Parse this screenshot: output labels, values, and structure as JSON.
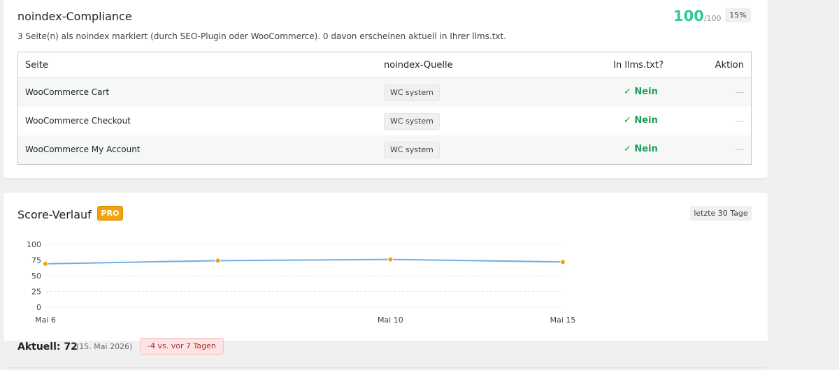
{
  "compliance": {
    "title": "noindex-Compliance",
    "score": "100",
    "score_max": "/100",
    "weight": "15%",
    "description": "3 Seite(n) als noindex markiert (durch SEO-Plugin oder WooCommerce). 0 davon erscheinen aktuell in Ihrer llms.txt.",
    "table": {
      "headers": [
        "Seite",
        "noindex-Quelle",
        "In llms.txt?",
        "Aktion"
      ],
      "rows": [
        {
          "page": "WooCommerce Cart",
          "source": "WC system",
          "in_llms": "✓ Nein",
          "action": "—"
        },
        {
          "page": "WooCommerce Checkout",
          "source": "WC system",
          "in_llms": "✓ Nein",
          "action": "—"
        },
        {
          "page": "WooCommerce My Account",
          "source": "WC system",
          "in_llms": "✓ Nein",
          "action": "—"
        }
      ]
    }
  },
  "history": {
    "title": "Score-Verlauf",
    "badge": "PRO",
    "range": "letzte 30 Tage",
    "current_label": "Aktuell: 72",
    "current_date": "(15. Mai 2026)",
    "delta": "-4 vs. vor 7 Tagen"
  },
  "chart_data": {
    "type": "line",
    "x": [
      "Mai 6",
      "",
      "Mai 10",
      "Mai 15"
    ],
    "x_tick_labels": [
      "Mai 6",
      "Mai 10",
      "Mai 15"
    ],
    "values": [
      69,
      74,
      76,
      72
    ],
    "y_ticks": [
      0,
      25,
      50,
      75,
      100
    ],
    "ylim": [
      0,
      100
    ],
    "grid": true,
    "line_color": "#72aee6",
    "point_color": "#f0a30a"
  },
  "colors": {
    "score_green": "#2ecc8f",
    "check_green": "#1f9d55",
    "pro_orange": "#f0a30a",
    "delta_red": "#b32d2e"
  }
}
